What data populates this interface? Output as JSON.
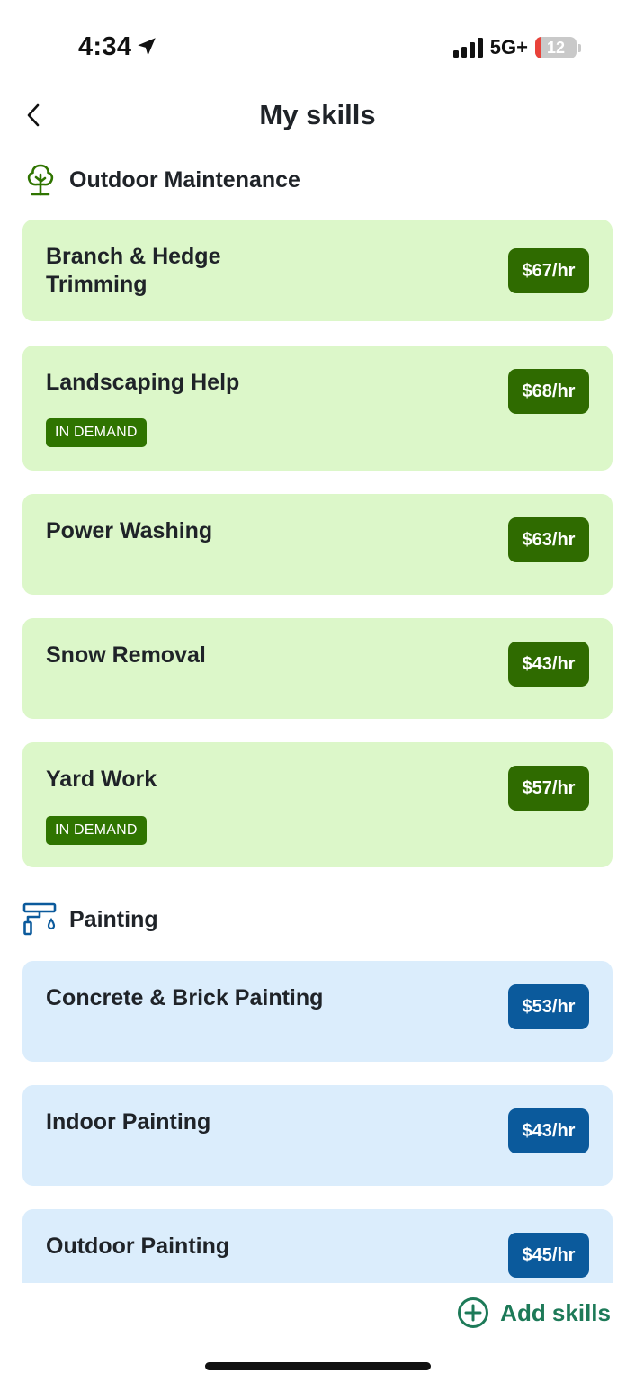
{
  "status_bar": {
    "time": "4:34",
    "network": "5G+",
    "battery_level": "12",
    "battery_fraction": 0.12,
    "battery_color": "#e9423a",
    "location_icon": "location-arrow-icon",
    "signal_icon": "cellular-signal-icon"
  },
  "header": {
    "title": "My skills",
    "back_icon": "chevron-left-icon"
  },
  "sections": [
    {
      "title": "Outdoor Maintenance",
      "icon": "tree-icon",
      "accent": "#2f7400",
      "card_color": "#dcf7c9",
      "skills": [
        {
          "name": "Branch & Hedge Trimming",
          "rate": "$67/hr",
          "badge": ""
        },
        {
          "name": "Landscaping Help",
          "rate": "$68/hr",
          "badge": "IN DEMAND"
        },
        {
          "name": "Power Washing",
          "rate": "$63/hr",
          "badge": ""
        },
        {
          "name": "Snow Removal",
          "rate": "$43/hr",
          "badge": ""
        },
        {
          "name": "Yard Work",
          "rate": "$57/hr",
          "badge": "IN DEMAND"
        }
      ]
    },
    {
      "title": "Painting",
      "icon": "paint-roller-icon",
      "accent": "#0b5a9c",
      "card_color": "#dbedfc",
      "skills": [
        {
          "name": "Concrete & Brick Painting",
          "rate": "$53/hr",
          "badge": ""
        },
        {
          "name": "Indoor Painting",
          "rate": "$43/hr",
          "badge": ""
        },
        {
          "name": "Outdoor Painting",
          "rate": "$45/hr",
          "badge": ""
        }
      ]
    }
  ],
  "footer": {
    "add_skills_label": "Add skills",
    "add_icon": "plus-circle-icon",
    "accent": "#1d7a58"
  }
}
